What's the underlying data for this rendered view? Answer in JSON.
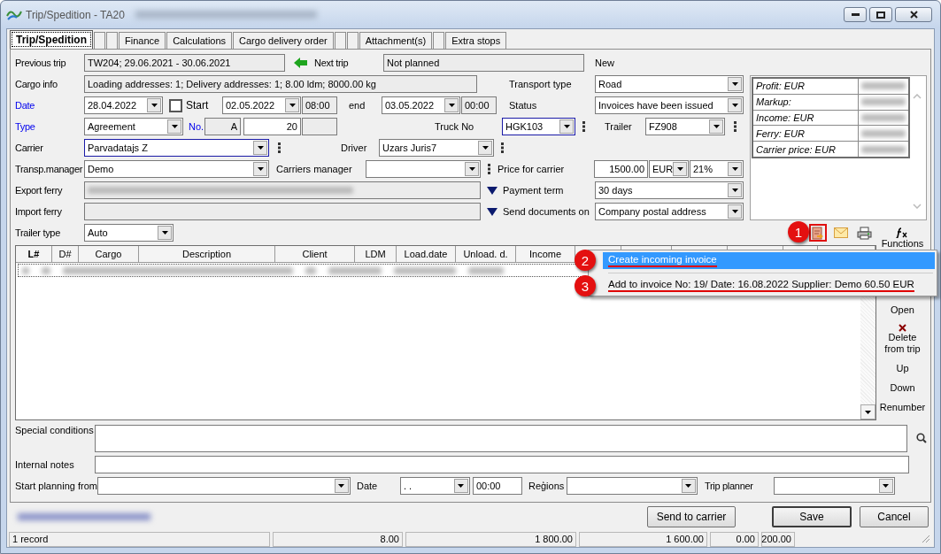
{
  "window": {
    "title": "Trip/Spedition  - TA20"
  },
  "tabs": [
    {
      "label": "Trip/Spedition",
      "selected": true
    },
    {
      "kind": "blank",
      "selected": false
    },
    {
      "kind": "blank",
      "selected": false
    },
    {
      "label": "Finance",
      "selected": false
    },
    {
      "label": "Calculations",
      "selected": false
    },
    {
      "label": "Cargo delivery order",
      "selected": false
    },
    {
      "kind": "blank",
      "selected": false
    },
    {
      "kind": "blank",
      "selected": false
    },
    {
      "label": "Attachment(s)",
      "selected": false
    },
    {
      "kind": "blank",
      "selected": false
    },
    {
      "label": "Extra stops",
      "selected": false
    }
  ],
  "form": {
    "previous_trip": {
      "label": "Previous trip",
      "value": "TW204; 29.06.2021 - 30.06.2021"
    },
    "next_trip": {
      "label": "Next trip",
      "value": "Not planned"
    },
    "trip_state": "New",
    "cargo_info": {
      "label": "Cargo info",
      "value": "Loading addresses: 1; Delivery addresses: 1; 8.00 ldm; 8000.00 kg"
    },
    "transport_type": {
      "label": "Transport type",
      "value": "Road"
    },
    "date": {
      "label": "Date",
      "link": true,
      "value": "28.04.2022"
    },
    "start": {
      "label": "Start",
      "checked": false,
      "date": "02.05.2022",
      "time": "08:00"
    },
    "end": {
      "label": "end",
      "date": "03.05.2022",
      "time": "00:00"
    },
    "status": {
      "label": "Status",
      "value": "Invoices have been issued"
    },
    "type": {
      "label": "Type",
      "link": true,
      "value": "Agreement"
    },
    "number": {
      "label": "No.",
      "link": true,
      "prefix": "A",
      "value": "20"
    },
    "truck_no": {
      "label": "Truck No",
      "value": "HGK103"
    },
    "trailer": {
      "label": "Trailer",
      "value": "FZ908"
    },
    "carrier": {
      "label": "Carrier",
      "value": "Parvadatajs Z"
    },
    "driver": {
      "label": "Driver",
      "value": "Uzars Juris7"
    },
    "transp_manager": {
      "label": "Transp.manager",
      "value": "Demo"
    },
    "carriers_manager": {
      "label": "Carriers manager"
    },
    "price_for_carrier": {
      "label": "Price for carrier",
      "value": "1500.00",
      "currency": "EUR",
      "vat": "21%"
    },
    "export_ferry": {
      "label": "Export ferry"
    },
    "payment_term": {
      "label": "Payment term",
      "value": "30 days"
    },
    "import_ferry": {
      "label": "Import ferry"
    },
    "send_documents_on": {
      "label": "Send documents on",
      "value": "Company postal address"
    },
    "trailer_type": {
      "label": "Trailer type",
      "value": "Auto"
    }
  },
  "summary": [
    {
      "label": "Profit: EUR"
    },
    {
      "label": "Markup:"
    },
    {
      "label": "Income: EUR"
    },
    {
      "label": "Ferry: EUR"
    },
    {
      "label": "Carrier price: EUR"
    }
  ],
  "toolbar": {
    "callout": "1",
    "functions_label": "Functions"
  },
  "table": {
    "columns": [
      "L#",
      "D#",
      "Cargo",
      "Description",
      "Client",
      "LDM",
      "Load.date",
      "Unload. d.",
      "Income"
    ]
  },
  "side_actions": [
    {
      "label": "Open"
    },
    {
      "label": "Delete from trip",
      "kind": "delete"
    },
    {
      "label": "Up"
    },
    {
      "label": "Down"
    },
    {
      "label": "Renumber"
    }
  ],
  "context_menu": [
    {
      "label": "Create incoming invoice",
      "selected": true,
      "callout": "2"
    },
    {
      "label": "Add to invoice No: 19/ Date: 16.08.2022 Supplier: Demo 60.50 EUR",
      "selected": false,
      "callout": "3"
    }
  ],
  "notes": {
    "special_conditions": "Special conditions",
    "internal_notes": "Internal notes"
  },
  "planning": {
    "start_planning_from": "Start planning from",
    "date_label": "Date",
    "date": ". .",
    "time": "00:00",
    "regions": "Reģions",
    "trip_planner": "Trip planner"
  },
  "buttons": [
    {
      "label": "Send to carrier"
    },
    {
      "label": "Save"
    },
    {
      "label": "Cancel"
    }
  ],
  "status_bar": [
    "1 record",
    "8.00",
    "1 800.00",
    "1 600.00",
    "0.00",
    "200.00"
  ]
}
